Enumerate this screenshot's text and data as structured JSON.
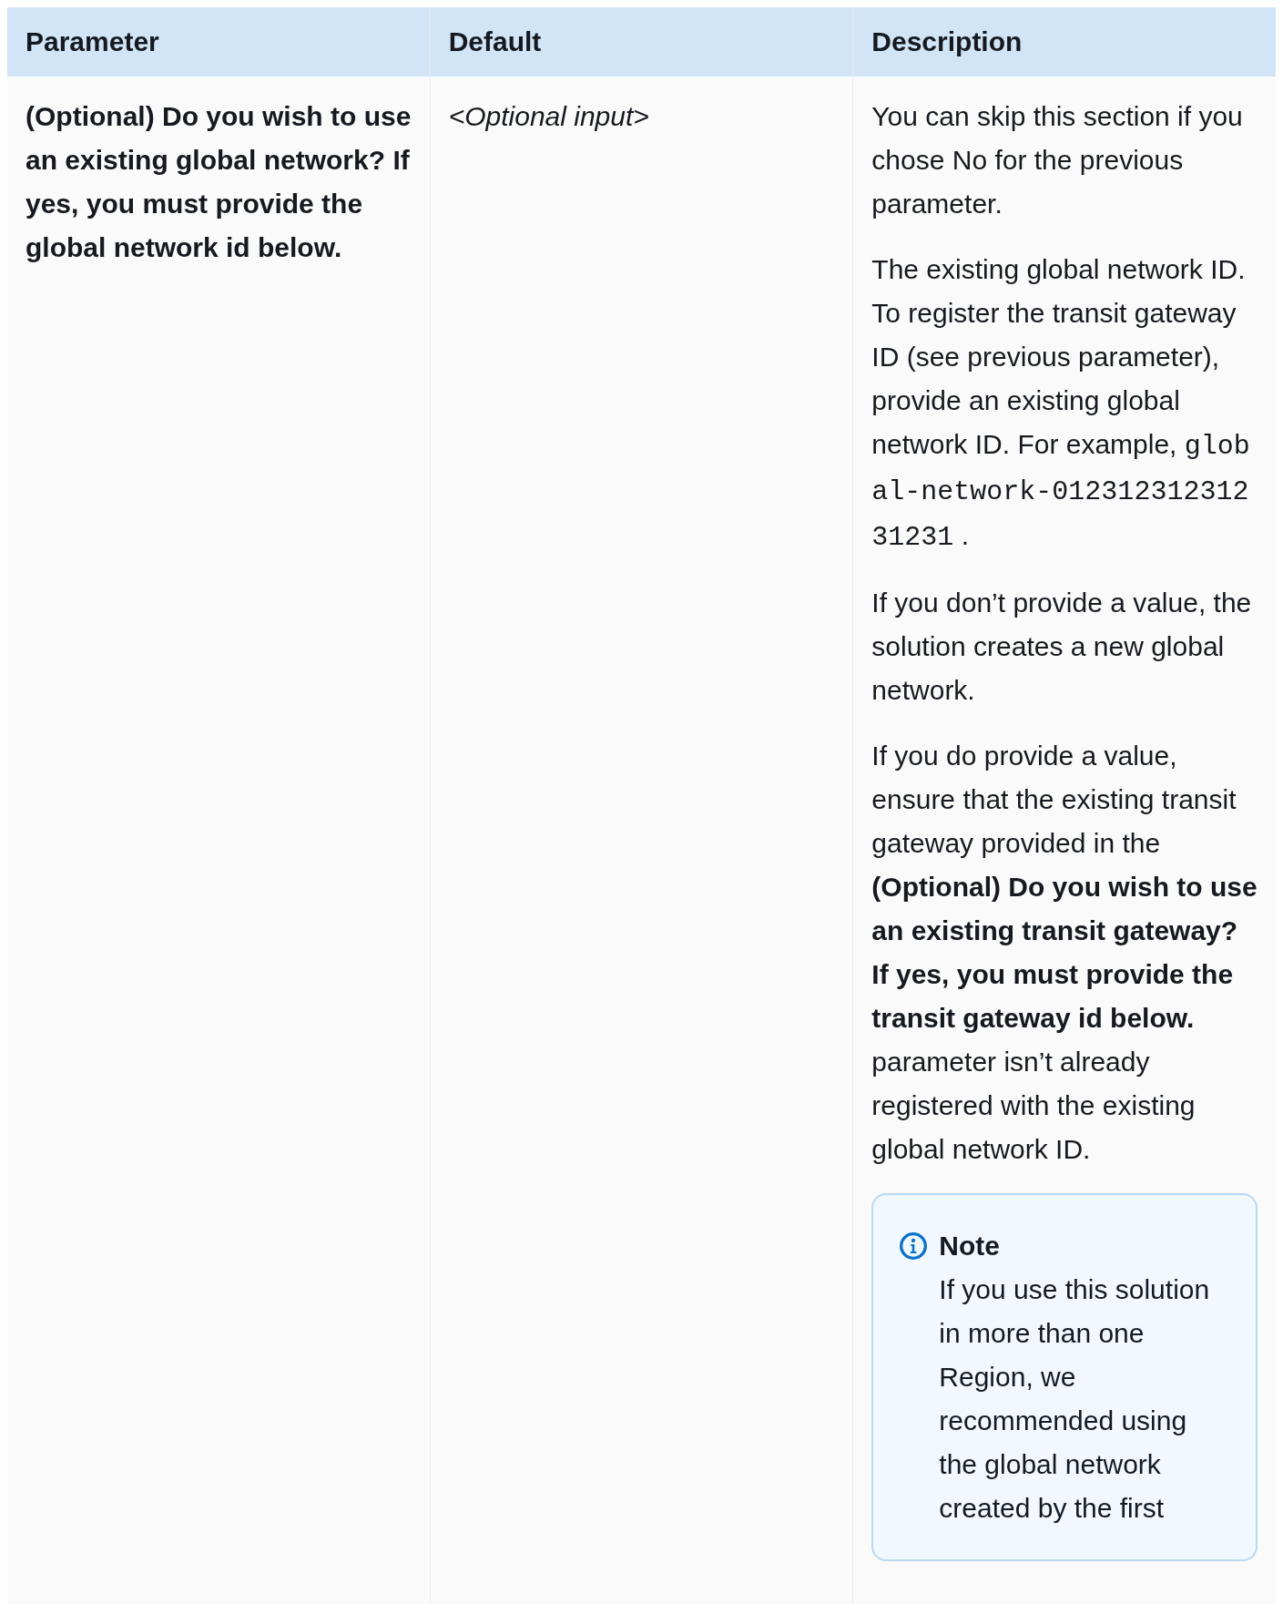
{
  "table": {
    "columns": [
      "Parameter",
      "Default",
      "Description"
    ],
    "rows": [
      {
        "parameter": "(Optional) Do you wish to use an existing global network? If yes, you must provide the global network id below.",
        "default": "<Optional input>",
        "description": [
          [
            {
              "kind": "text",
              "text": "You can skip this section if you chose No for the previous parameter."
            }
          ],
          [
            {
              "kind": "text",
              "text": "The existing global network ID. To register the transit gateway ID (see previous parameter), provide an existing global network ID. For example, "
            },
            {
              "kind": "code",
              "text": "global-network-01231231231231231"
            },
            {
              "kind": "text",
              "text": " ."
            }
          ],
          [
            {
              "kind": "text",
              "text": "If you don’t provide a value, the solution creates a new global network."
            }
          ],
          [
            {
              "kind": "text",
              "text": "If you do provide a value, ensure that the existing transit gateway provided in the **(Optional) Do you wish to use an existing transit gateway? If yes, you must provide the transit gateway id below.** parameter isn’t already registered with the existing global network ID."
            }
          ]
        ],
        "note": {
          "title": "Note",
          "text": "If you use this solution in more than one Region, we recommended using the global network created by the first"
        }
      }
    ]
  }
}
